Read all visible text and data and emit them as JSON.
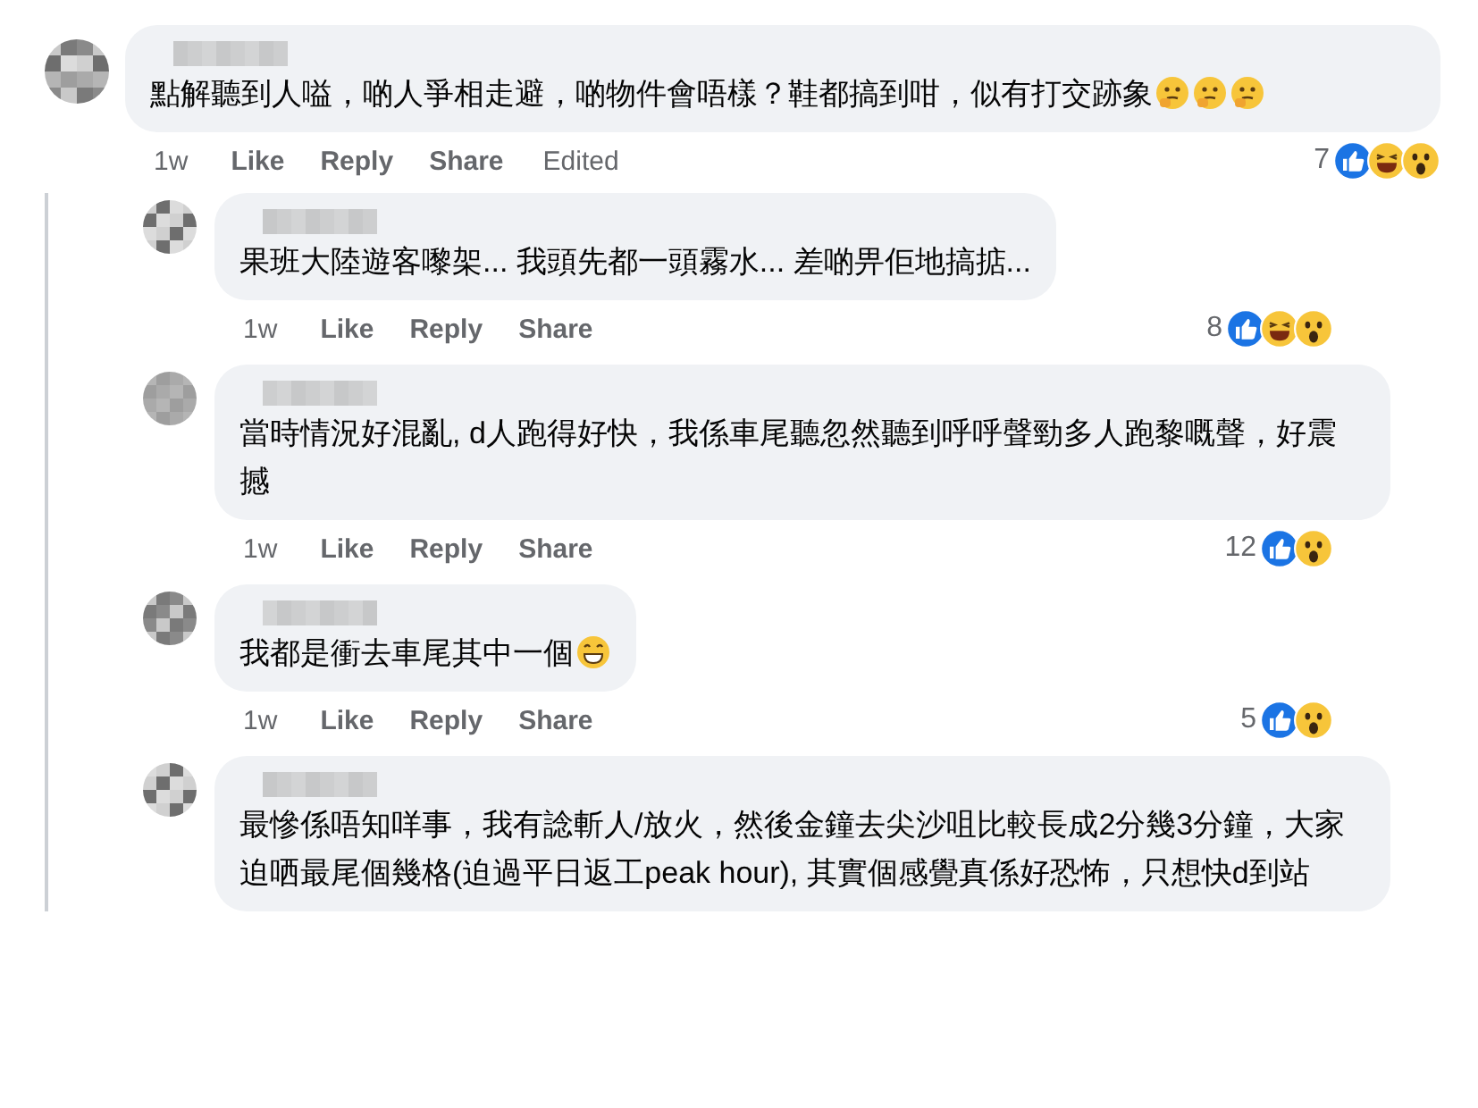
{
  "comments": [
    {
      "text": "點解聽到人嗌，啲人爭相走避，啲物件會唔樣？鞋都搞到咁，似有打交跡象",
      "emoji": [
        {
          "kind": "thinking"
        },
        {
          "kind": "thinking"
        },
        {
          "kind": "thinking"
        }
      ],
      "time": "1w",
      "actions": [
        "Like",
        "Reply",
        "Share"
      ],
      "edited": "Edited",
      "count": "7",
      "reactions": [
        {
          "kind": "like"
        },
        {
          "kind": "haha"
        },
        {
          "kind": "wow"
        }
      ],
      "replies": [
        {
          "text": "果班大陸遊客嚟架... 我頭先都一頭霧水... 差啲畀佢地搞掂...",
          "time": "1w",
          "actions": [
            "Like",
            "Reply",
            "Share"
          ],
          "count": "8",
          "reactions": [
            {
              "kind": "like"
            },
            {
              "kind": "haha"
            },
            {
              "kind": "wow"
            }
          ]
        },
        {
          "text": "當時情況好混亂, d人跑得好快，我係車尾聽忽然聽到呼呼聲勁多人跑黎嘅聲，好震撼",
          "time": "1w",
          "actions": [
            "Like",
            "Reply",
            "Share"
          ],
          "count": "12",
          "reactions": [
            {
              "kind": "like"
            },
            {
              "kind": "wow"
            }
          ]
        },
        {
          "text": "我都是衝去車尾其中一個",
          "emoji": [
            {
              "kind": "grin"
            }
          ],
          "time": "1w",
          "actions": [
            "Like",
            "Reply",
            "Share"
          ],
          "count": "5",
          "reactions": [
            {
              "kind": "like"
            },
            {
              "kind": "wow"
            }
          ]
        },
        {
          "text": "最慘係唔知咩事，我有諗斬人/放火，然後金鐘去尖沙咀比較長成2分幾3分鐘，大家迫哂最尾個幾格(迫過平日返工peak hour), 其實個感覺真係好恐怖，只想快d到站"
        }
      ]
    }
  ]
}
